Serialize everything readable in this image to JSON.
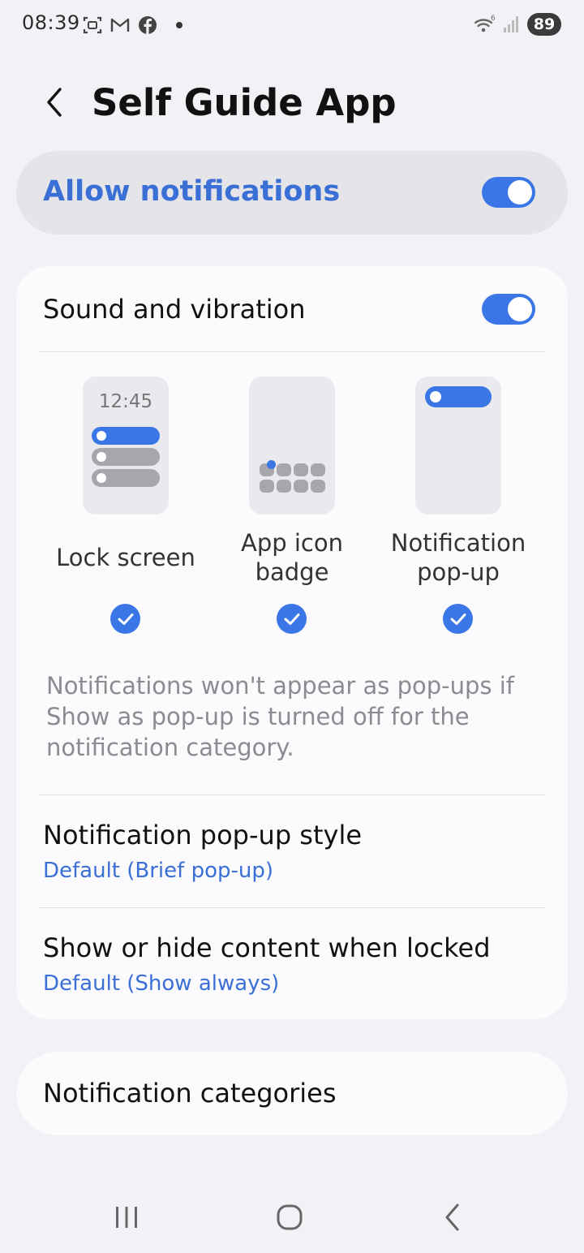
{
  "status_bar": {
    "time": "08:39",
    "icons_left": [
      "screenshot-icon",
      "gmail-icon",
      "facebook-icon"
    ],
    "battery": "89"
  },
  "header": {
    "title": "Self Guide App"
  },
  "allow_notifications": {
    "label": "Allow notifications",
    "enabled": true
  },
  "sound": {
    "label": "Sound and vibration",
    "enabled": true
  },
  "styles": {
    "lock_screen": {
      "label": "Lock screen",
      "time": "12:45",
      "checked": true
    },
    "app_icon_badge": {
      "label_line1": "App icon",
      "label_line2": "badge",
      "checked": true
    },
    "notification_popup": {
      "label_line1": "Notification",
      "label_line2": "pop-up",
      "checked": true
    }
  },
  "info_text": "Notifications won't appear as pop-ups if Show as pop-up is turned off for the notification category.",
  "popup_style": {
    "title": "Notification pop-up style",
    "value": "Default (Brief pop-up)"
  },
  "lock_content": {
    "title": "Show or hide content when locked",
    "value": "Default (Show always)"
  },
  "categories": {
    "label": "Notification categories"
  },
  "colors": {
    "accent": "#3a76e6",
    "link": "#3a6fd6",
    "background": "#f2f2f6",
    "card": "#fbfbfe"
  }
}
